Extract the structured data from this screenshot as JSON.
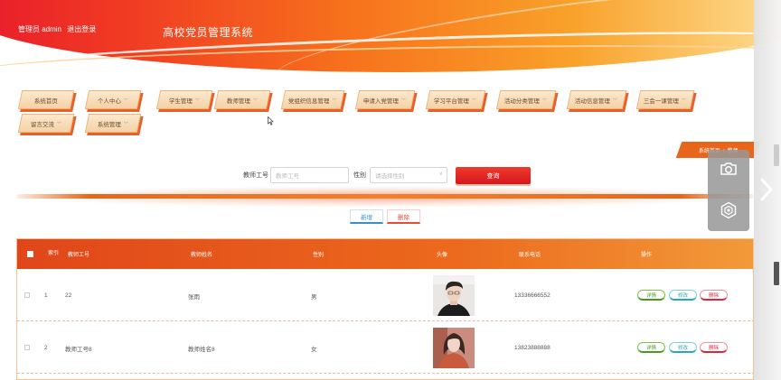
{
  "header": {
    "welcome": "管理员 admin",
    "logout": "退出登录",
    "title": "高校党员管理系统"
  },
  "nav": [
    {
      "label": "系统首页",
      "dropdown": false
    },
    {
      "label": "个人中心",
      "dropdown": true
    },
    {
      "label": "学生管理",
      "dropdown": true
    },
    {
      "label": "教师管理",
      "dropdown": true
    },
    {
      "label": "党组织信息管理",
      "dropdown": true
    },
    {
      "label": "申请入党管理",
      "dropdown": true
    },
    {
      "label": "学习平台管理",
      "dropdown": true
    },
    {
      "label": "活动分类管理",
      "dropdown": true
    },
    {
      "label": "活动信息管理",
      "dropdown": true
    },
    {
      "label": "三会一课管理",
      "dropdown": true
    },
    {
      "label": "留言交流",
      "dropdown": true
    },
    {
      "label": "系统管理",
      "dropdown": true
    }
  ],
  "breadcrumb": {
    "home": "系统首页",
    "sep": "/",
    "current": "教师"
  },
  "search": {
    "teacher_no_label": "教师工号",
    "teacher_no_placeholder": "教师工号",
    "gender_label": "性别",
    "gender_placeholder": "请选择性别",
    "query_label": "查询"
  },
  "actions": {
    "add": "新增",
    "delete": "删除"
  },
  "table": {
    "headers": [
      "索引",
      "教师工号",
      "教师姓名",
      "性别",
      "头像",
      "联系电话",
      "操作"
    ],
    "rows": [
      {
        "index": "1",
        "teacher_no": "22",
        "name": "张雨",
        "gender": "男",
        "phone": "13336666552"
      },
      {
        "index": "2",
        "teacher_no": "教师工号8",
        "name": "教师姓名8",
        "gender": "女",
        "phone": "13823888888"
      }
    ],
    "ops": {
      "detail": "详情",
      "edit": "修改",
      "delete": "删除"
    }
  },
  "colors": {
    "primary": "#e8661c",
    "danger": "#d8283f",
    "header_red": "#e8192c"
  }
}
